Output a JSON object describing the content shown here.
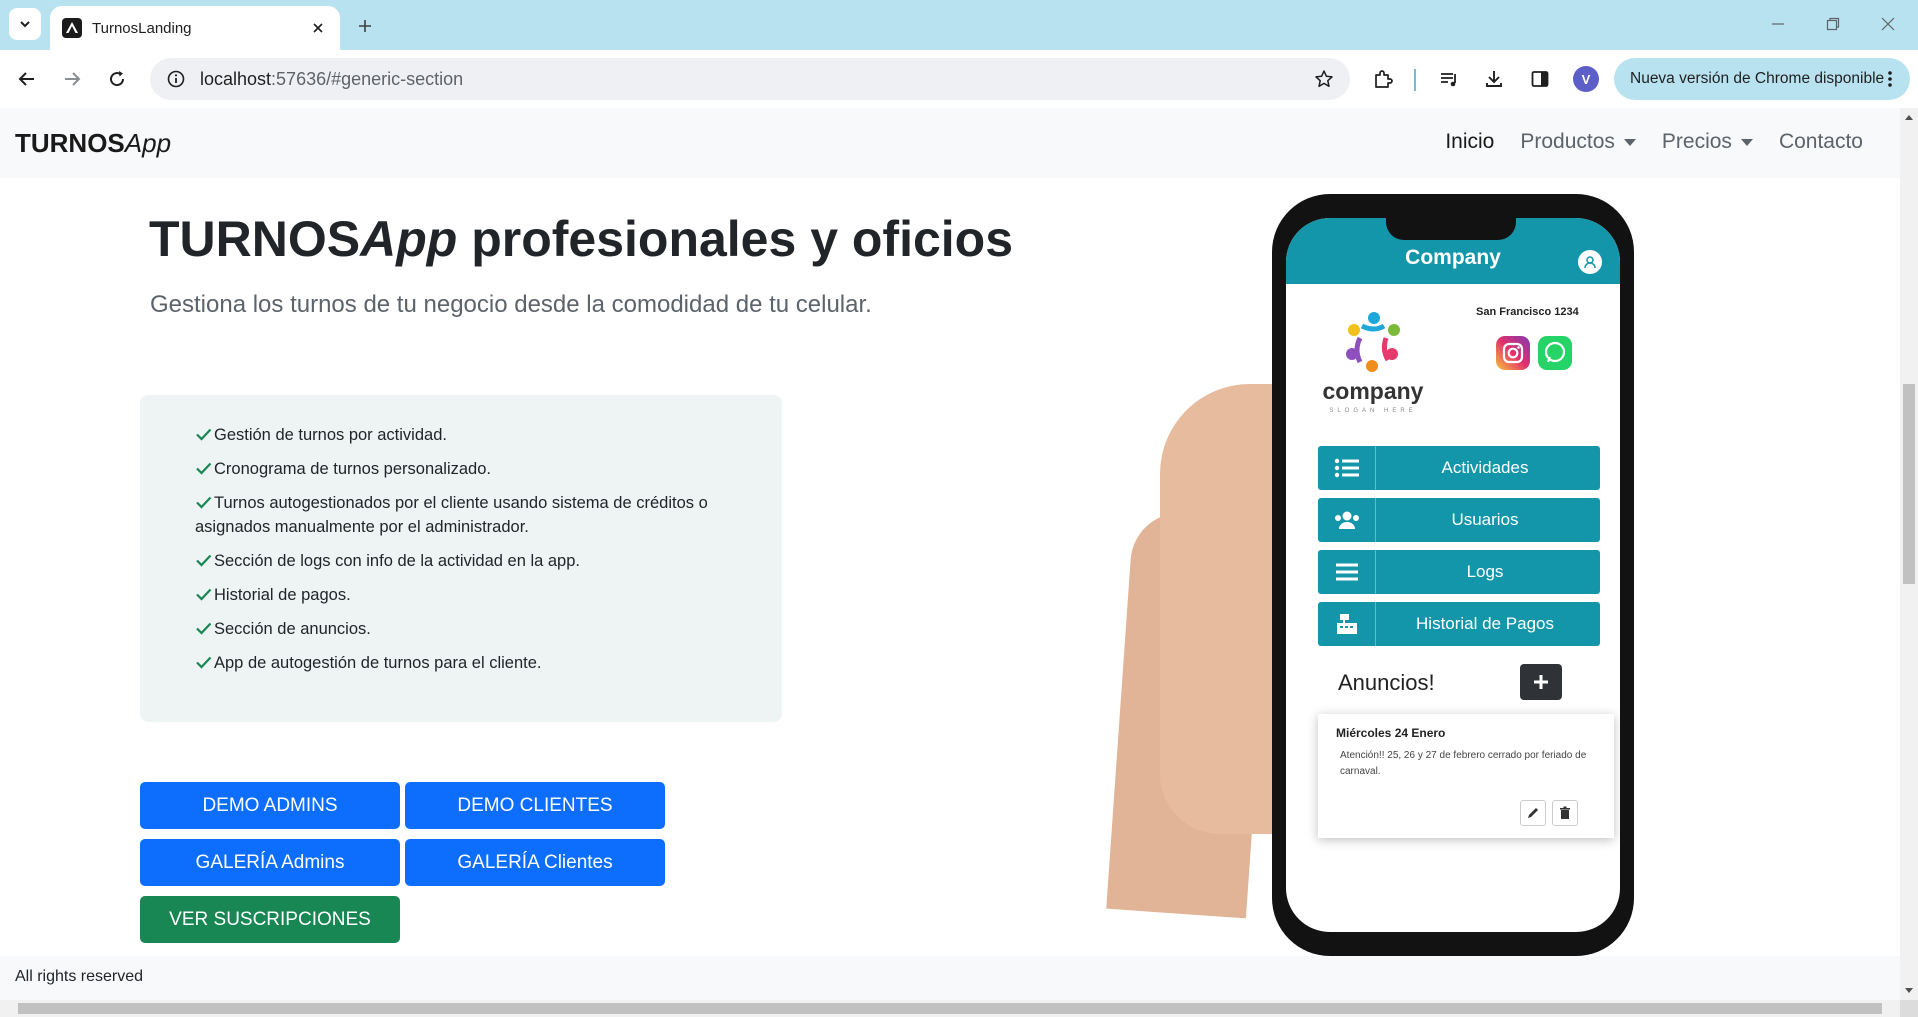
{
  "browser": {
    "tab_title": "TurnosLanding",
    "url_host": "localhost",
    "url_path": ":57636/#generic-section",
    "update_label": "Nueva versión de Chrome disponible",
    "profile_initial": "V"
  },
  "navbar": {
    "brand_bold": "TURNOS",
    "brand_italic": "App",
    "links": [
      {
        "label": "Inicio",
        "active": true
      },
      {
        "label": "Productos",
        "dropdown": true
      },
      {
        "label": "Precios",
        "dropdown": true
      },
      {
        "label": "Contacto"
      }
    ]
  },
  "hero": {
    "title_bold": "TURNOS",
    "title_italic": "App",
    "title_rest": " profesionales y oficios",
    "subtitle": "Gestiona los turnos de tu negocio desde la comodidad de tu celular."
  },
  "features": [
    "Gestión de turnos por actividad.",
    "Cronograma de turnos personalizado.",
    "Turnos autogestionados por el cliente usando sistema de créditos o asignados manualmente por el administrador.",
    "Sección de logs con info de la actividad en la app.",
    "Historial de pagos.",
    "Sección de anuncios.",
    "App de autogestión de turnos para el cliente."
  ],
  "buttons": {
    "demo_admins": "DEMO ADMINS",
    "demo_clientes": "DEMO CLIENTES",
    "galeria_admins": "GALERÍA Admins",
    "galeria_clientes": "GALERÍA Clientes",
    "ver_suscripciones": "VER SUSCRIPCIONES"
  },
  "phone": {
    "company": "Company",
    "logo_text": "company",
    "slogan": "SLOGAN HERE",
    "address": "San Francisco 1234",
    "menu": [
      "Actividades",
      "Usuarios",
      "Logs",
      "Historial de Pagos"
    ],
    "anuncios_title": "Anuncios!",
    "card_date": "Miércoles 24 Enero",
    "card_text": "Atención!! 25, 26 y 27 de febrero cerrado por feriado de carnaval.",
    "accent": "#1396a9"
  },
  "footer": {
    "text": "All rights reserved"
  },
  "colors": {
    "primary": "#0d6efd",
    "success": "#198754",
    "chrome_frame": "#b8e2f0"
  }
}
